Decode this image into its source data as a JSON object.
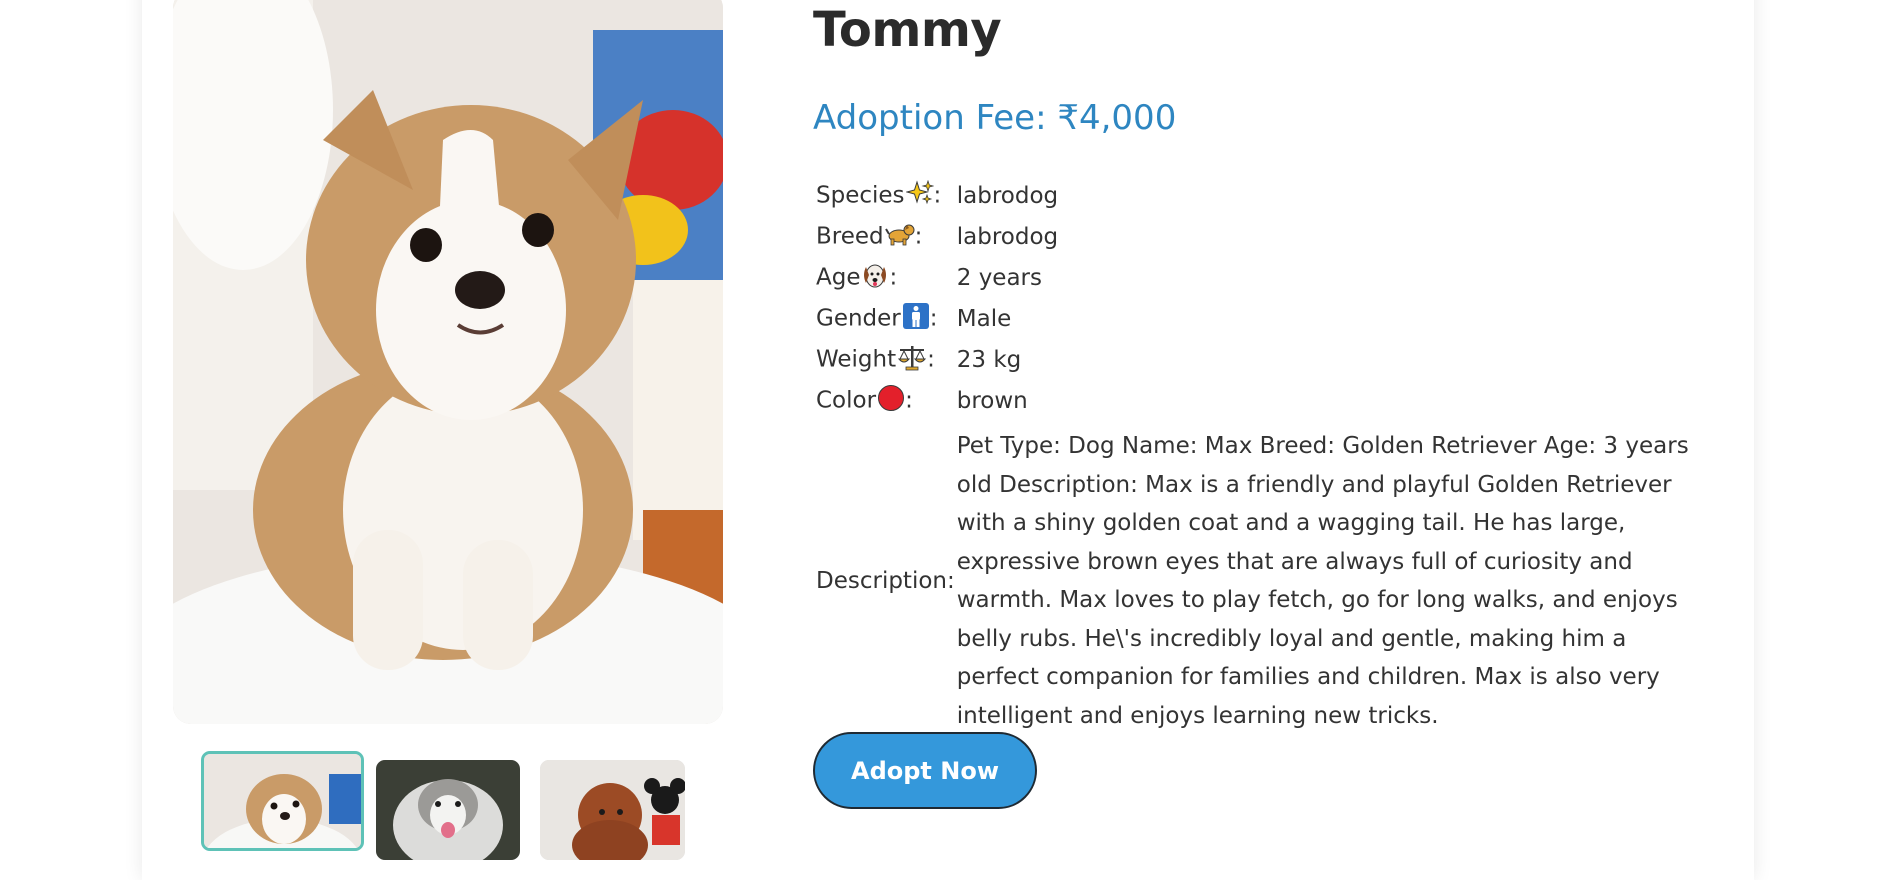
{
  "pet": {
    "name": "Tommy",
    "adoption_fee": "Adoption Fee: ₹4,000"
  },
  "attributes": [
    {
      "label": "Species",
      "icon": "sparkles-icon",
      "sep": ":",
      "value": "labrodog"
    },
    {
      "label": "Breed",
      "icon": "dog-icon",
      "sep": ":",
      "value": "labrodog"
    },
    {
      "label": "Age",
      "icon": "dog-face-icon",
      "sep": ":",
      "value": "2 years"
    },
    {
      "label": "Gender",
      "icon": "male-sign-icon",
      "sep": ":",
      "value": "Male"
    },
    {
      "label": "Weight",
      "icon": "scales-icon",
      "sep": ":",
      "value": "23 kg"
    },
    {
      "label": "Color",
      "icon": "red-circle-icon",
      "sep": ":",
      "value": "brown"
    }
  ],
  "description": {
    "label": "Description:",
    "text": "Pet Type: Dog Name: Max Breed: Golden Retriever Age: 3 years old Description: Max is a friendly and playful Golden Retriever with a shiny golden coat and a wagging tail. He has large, expressive brown eyes that are always full of curiosity and warmth. Max loves to play fetch, go for long walks, and enjoys belly rubs. He\\'s incredibly loyal and gentle, making him a perfect companion for families and children. Max is also very intelligent and enjoys learning new tricks."
  },
  "actions": {
    "adopt_label": "Adopt Now"
  },
  "colors": {
    "accent": "#3498db",
    "fee_text": "#2e86c1",
    "thumb_active_border": "#5ec2b7"
  }
}
